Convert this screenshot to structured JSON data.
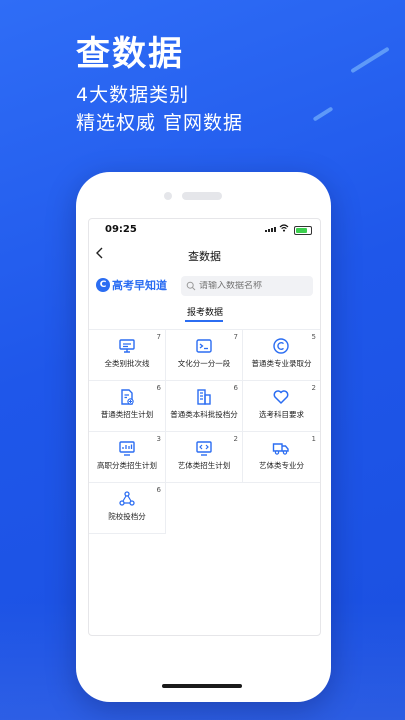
{
  "hero": {
    "title": "查数据",
    "line1": "4大数据类别",
    "line2": "精选权威 官网数据"
  },
  "status_bar": {
    "time": "09:25"
  },
  "navbar": {
    "title": "查数据"
  },
  "logo": {
    "mark": "C",
    "text": "高考早知道"
  },
  "search": {
    "placeholder": "请输入数据名称"
  },
  "tabs": [
    {
      "label": "报考数据",
      "active": true
    }
  ],
  "colors": {
    "accent": "#2b6df2",
    "background": "#1f57ea"
  },
  "grid_items": [
    {
      "label": "全类别批次线",
      "count": "7",
      "icon": "monitor-icon"
    },
    {
      "label": "文化分一分一段",
      "count": "7",
      "icon": "terminal-icon"
    },
    {
      "label": "普通类专业录取分",
      "count": "5",
      "icon": "copyright-icon"
    },
    {
      "label": "普通类招生计划",
      "count": "6",
      "icon": "document-icon"
    },
    {
      "label": "普通类本科批投档分",
      "count": "6",
      "icon": "building-icon"
    },
    {
      "label": "选考科目要求",
      "count": "2",
      "icon": "heart-icon"
    },
    {
      "label": "高职分类招生计划",
      "count": "3",
      "icon": "monitor-chart-icon"
    },
    {
      "label": "艺体类招生计划",
      "count": "2",
      "icon": "code-screen-icon"
    },
    {
      "label": "艺体类专业分",
      "count": "1",
      "icon": "truck-icon"
    },
    {
      "label": "院校投档分",
      "count": "6",
      "icon": "network-icon"
    }
  ]
}
